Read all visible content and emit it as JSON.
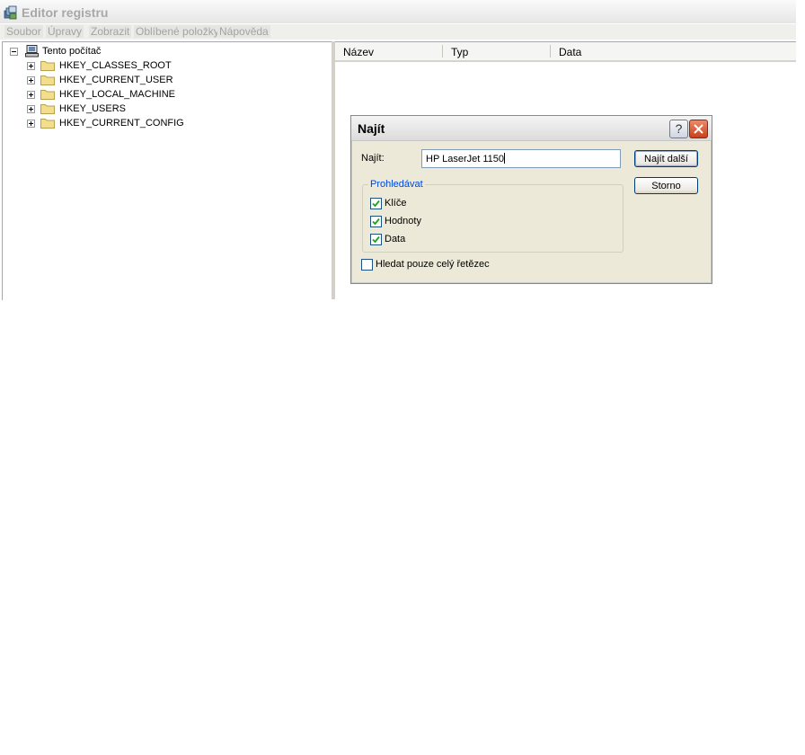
{
  "window": {
    "title": "Editor registru",
    "icon": "regedit-icon"
  },
  "menu": [
    "Soubor",
    "Úpravy",
    "Zobrazit",
    "Oblíbené položky",
    "Nápověda"
  ],
  "tree": {
    "root": "Tento počítač",
    "keys": [
      "HKEY_CLASSES_ROOT",
      "HKEY_CURRENT_USER",
      "HKEY_LOCAL_MACHINE",
      "HKEY_USERS",
      "HKEY_CURRENT_CONFIG"
    ]
  },
  "list": {
    "columns": [
      "Název",
      "Typ",
      "Data"
    ]
  },
  "dialog": {
    "title": "Najít",
    "find_label": "Najít:",
    "find_value": "HP LaserJet 1150",
    "find_next_button": "Najít další",
    "cancel_button": "Storno",
    "search_group_title": "Prohledávat",
    "options": [
      {
        "label": "Klíče",
        "checked": true
      },
      {
        "label": "Hodnoty",
        "checked": true
      },
      {
        "label": "Data",
        "checked": true
      }
    ],
    "whole_string": {
      "label": "Hledat pouze celý řetězec",
      "checked": false
    }
  }
}
